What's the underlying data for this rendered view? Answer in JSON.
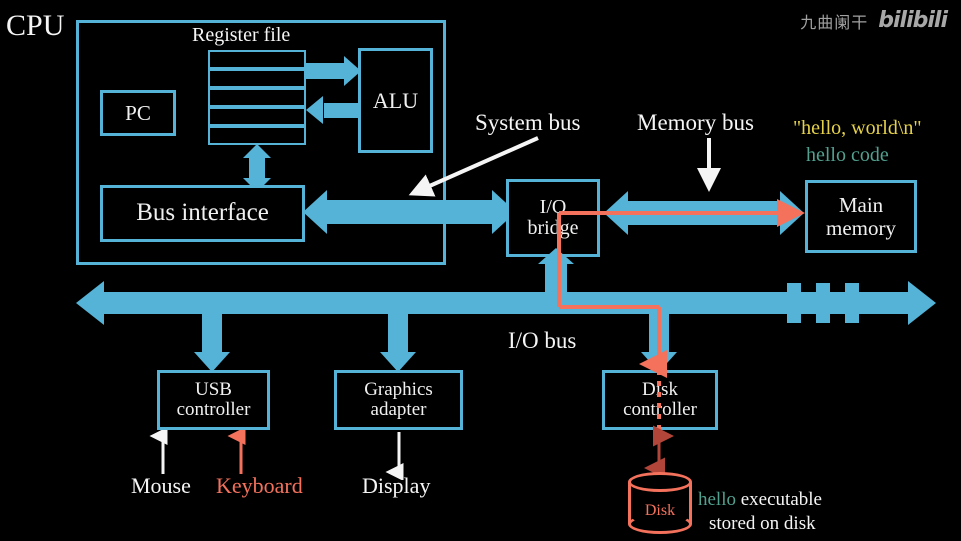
{
  "watermark": {
    "channel": "九曲阑干",
    "logo": "bilibili"
  },
  "labels": {
    "cpu": "CPU",
    "register_file": "Register file",
    "pc": "PC",
    "alu": "ALU",
    "bus_interface": "Bus interface",
    "system_bus": "System bus",
    "memory_bus": "Memory bus",
    "io_bridge_line1": "I/O",
    "io_bridge_line2": "bridge",
    "main_memory_line1": "Main",
    "main_memory_line2": "memory",
    "io_bus": "I/O bus",
    "usb_controller_line1": "USB",
    "usb_controller_line2": "controller",
    "graphics_adapter_line1": "Graphics",
    "graphics_adapter_line2": "adapter",
    "disk_controller_line1": "Disk",
    "disk_controller_line2": "controller",
    "mouse": "Mouse",
    "keyboard": "Keyboard",
    "display": "Display",
    "disk": "Disk"
  },
  "annotations": {
    "memory_string": "\"hello, world\\n\"",
    "memory_code": "hello code",
    "disk_note_highlight": "hello",
    "disk_note_line1_rest": "executable",
    "disk_note_line2": "stored on disk"
  },
  "colors": {
    "accent_blue": "#54b3d6",
    "highlight_red": "#f4715c",
    "string_yellow": "#e6d24a",
    "code_teal": "#53a08f",
    "text_white": "#f5f5f5",
    "background": "#000000"
  },
  "register_file": {
    "row_count": 5
  },
  "expansion_slots": {
    "count": 3
  }
}
